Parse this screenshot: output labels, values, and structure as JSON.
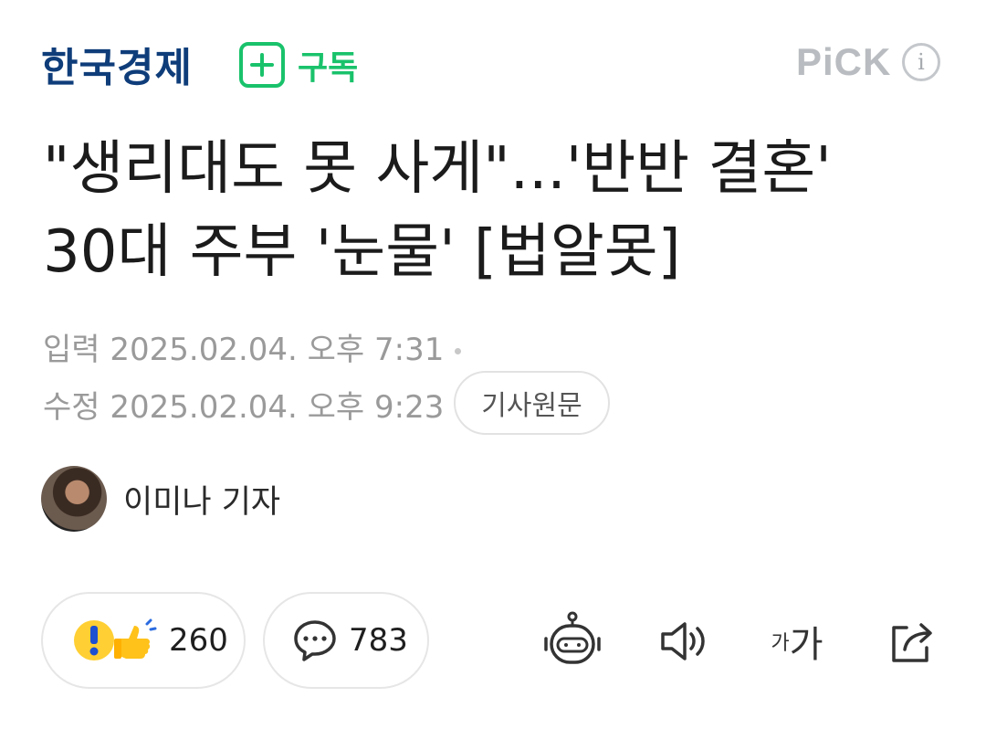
{
  "header": {
    "brand": "한국경제",
    "subscribe_label": "구독",
    "pick_label": "PiCK",
    "info_label": "i"
  },
  "article": {
    "title_line1": "\"생리대도 못 사게\"...'반반 결혼'",
    "title_line2": "30대 주부 '눈물' [법알못]",
    "published": "입력 2025.02.04. 오후 7:31",
    "modified": "수정 2025.02.04. 오후 9:23",
    "original_link_label": "기사원문",
    "author": "이미나 기자"
  },
  "actions": {
    "reaction_count": "260",
    "comment_count": "783"
  },
  "colors": {
    "brand": "#0f3d7a",
    "subscribe": "#19c26b",
    "pick": "#b9bcc0"
  },
  "icons": [
    "plus-icon",
    "info-icon",
    "reaction-icon",
    "comment-icon",
    "robot-summary-icon",
    "speaker-icon",
    "font-size-icon",
    "share-icon"
  ]
}
